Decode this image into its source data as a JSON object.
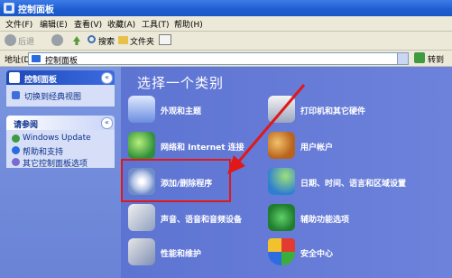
{
  "window": {
    "title": "控制面板"
  },
  "menu": [
    "文件(F)",
    "编辑(E)",
    "查看(V)",
    "收藏(A)",
    "工具(T)",
    "帮助(H)"
  ],
  "toolbar": {
    "back": "后退",
    "search": "搜索",
    "folders": "文件夹"
  },
  "address": {
    "label": "地址(D)",
    "value": "控制面板",
    "go": "转到"
  },
  "left": {
    "panel_title": "控制面板",
    "switch_view": "切换到经典视图",
    "see_also_title": "请参阅",
    "see_also": [
      "Windows Update",
      "帮助和支持",
      "其它控制面板选项"
    ]
  },
  "main": {
    "heading": "选择一个类别",
    "categories": [
      "外观和主题",
      "打印机和其它硬件",
      "网络和 Internet 连接",
      "用户帐户",
      "添加/删除程序",
      "日期、时间、语言和区域设置",
      "声音、语音和音频设备",
      "辅助功能选项",
      "性能和维护",
      "安全中心"
    ]
  },
  "colors": {
    "annotation": "#e01818",
    "main_bg": "#6c82db",
    "titlebar": "#1f5fd1"
  }
}
